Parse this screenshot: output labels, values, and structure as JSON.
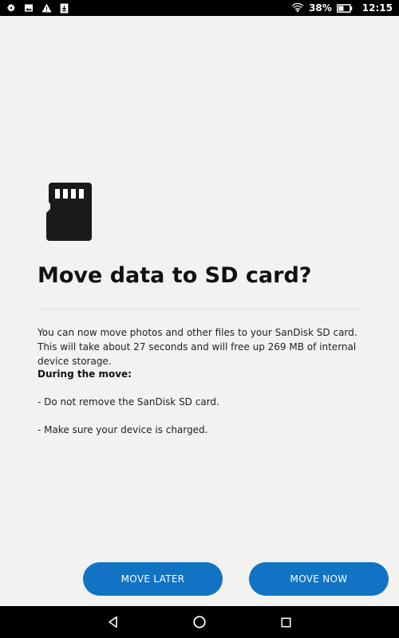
{
  "status_bar": {
    "icons_left": [
      "gear-icon",
      "image-notification-icon",
      "warning-icon",
      "download-icon"
    ],
    "icons_right": [
      "wifi-icon",
      "battery-icon"
    ],
    "battery_percent": "38%",
    "time": "12:15"
  },
  "dialog": {
    "icon": "sd-card-icon",
    "title": "Move data to SD card?",
    "body": "You can now move photos and other files to your SanDisk SD card. This will take about 27 seconds and will free up 269 MB of internal device storage.",
    "section_heading": "During the move:",
    "bullets": [
      "- Do not remove the SanDisk SD card.",
      "- Make sure your device is charged."
    ]
  },
  "buttons": {
    "later_label": "MOVE LATER",
    "now_label": "MOVE NOW"
  },
  "nav_bar": {
    "icons": [
      "back-icon",
      "home-icon",
      "recents-icon"
    ]
  },
  "colors": {
    "accent": "#1273c4",
    "background": "#f2f2f0",
    "bars": "#000000"
  }
}
